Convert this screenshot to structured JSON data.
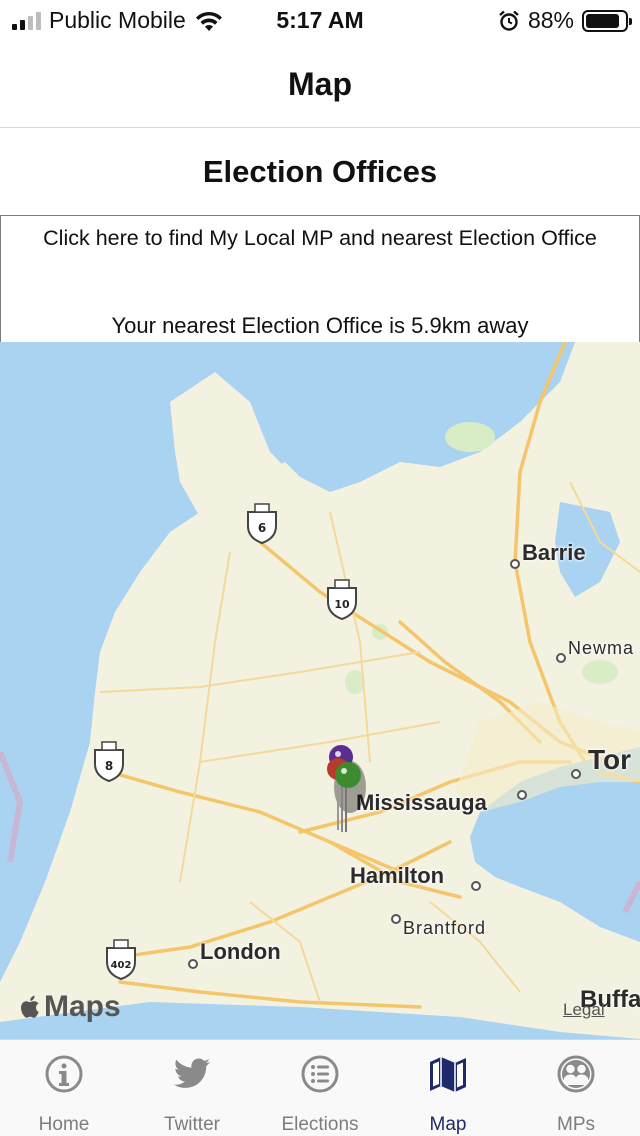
{
  "status_bar": {
    "carrier": "Public Mobile",
    "time": "5:17 AM",
    "battery_percent": "88%",
    "battery_level": 0.88
  },
  "nav": {
    "title": "Map"
  },
  "section": {
    "title": "Election Offices"
  },
  "info": {
    "find_link": "Click here to find My Local MP and nearest Election Office",
    "nearest_distance": "Your nearest Election Office is 5.9km away"
  },
  "map": {
    "cities": {
      "barrie": "Barrie",
      "newmarket": "Newma",
      "toronto": "Tor",
      "mississauga": "Mississauga",
      "hamilton": "Hamilton",
      "brantford": "Brantford",
      "london": "London",
      "buffalo": "Buffa"
    },
    "highways": {
      "h6": "6",
      "h10": "10",
      "h8": "8",
      "h402": "402"
    },
    "attribution": "Maps",
    "legal": "Legal",
    "colors": {
      "water": "#aad3f2",
      "land": "#f3f1e0",
      "road": "#f5c56c",
      "park": "#d8ecc6"
    }
  },
  "tabs": [
    {
      "label": "Home",
      "icon": "info-circle-icon",
      "active": false
    },
    {
      "label": "Twitter",
      "icon": "twitter-bird-icon",
      "active": false
    },
    {
      "label": "Elections",
      "icon": "list-circle-icon",
      "active": false
    },
    {
      "label": "Map",
      "icon": "folded-map-icon",
      "active": true
    },
    {
      "label": "MPs",
      "icon": "people-circle-icon",
      "active": false
    }
  ]
}
